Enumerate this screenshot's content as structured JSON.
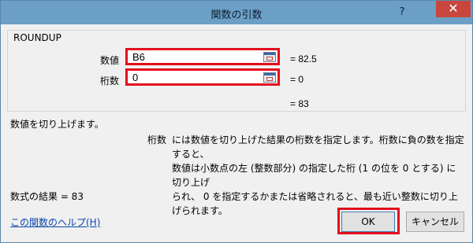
{
  "window": {
    "title": "関数の引数",
    "help_symbol": "?",
    "close_symbol": "✕"
  },
  "function_name": "ROUNDUP",
  "arguments": [
    {
      "label": "数値",
      "value": "B6",
      "result": "=  82.5",
      "ref_icon": "cell-reference-icon"
    },
    {
      "label": "桁数",
      "value": "0",
      "result": "=  0",
      "ref_icon": "cell-reference-icon"
    }
  ],
  "function_result": "=  83",
  "description": "数値を切り上げます。",
  "argument_description": {
    "label": "桁数",
    "lines": [
      "には数値を切り上げた結果の桁数を指定します。桁数に負の数を指定すると、",
      "数値は小数点の左 (整数部分) の指定した桁 (1 の位を 0 とする) に切り上げ",
      "られ、 0 を指定するかまたは省略されると、最も近い整数に切り上げられます。"
    ]
  },
  "formula_result": "数式の結果 =   83",
  "help_link": "この関数のヘルプ(H)",
  "buttons": {
    "ok": "OK",
    "cancel": "キャンセル"
  },
  "colors": {
    "titlebar": "#6b9fc6",
    "close": "#c8463d",
    "highlight": "#e30d1d",
    "link": "#0645ad"
  }
}
